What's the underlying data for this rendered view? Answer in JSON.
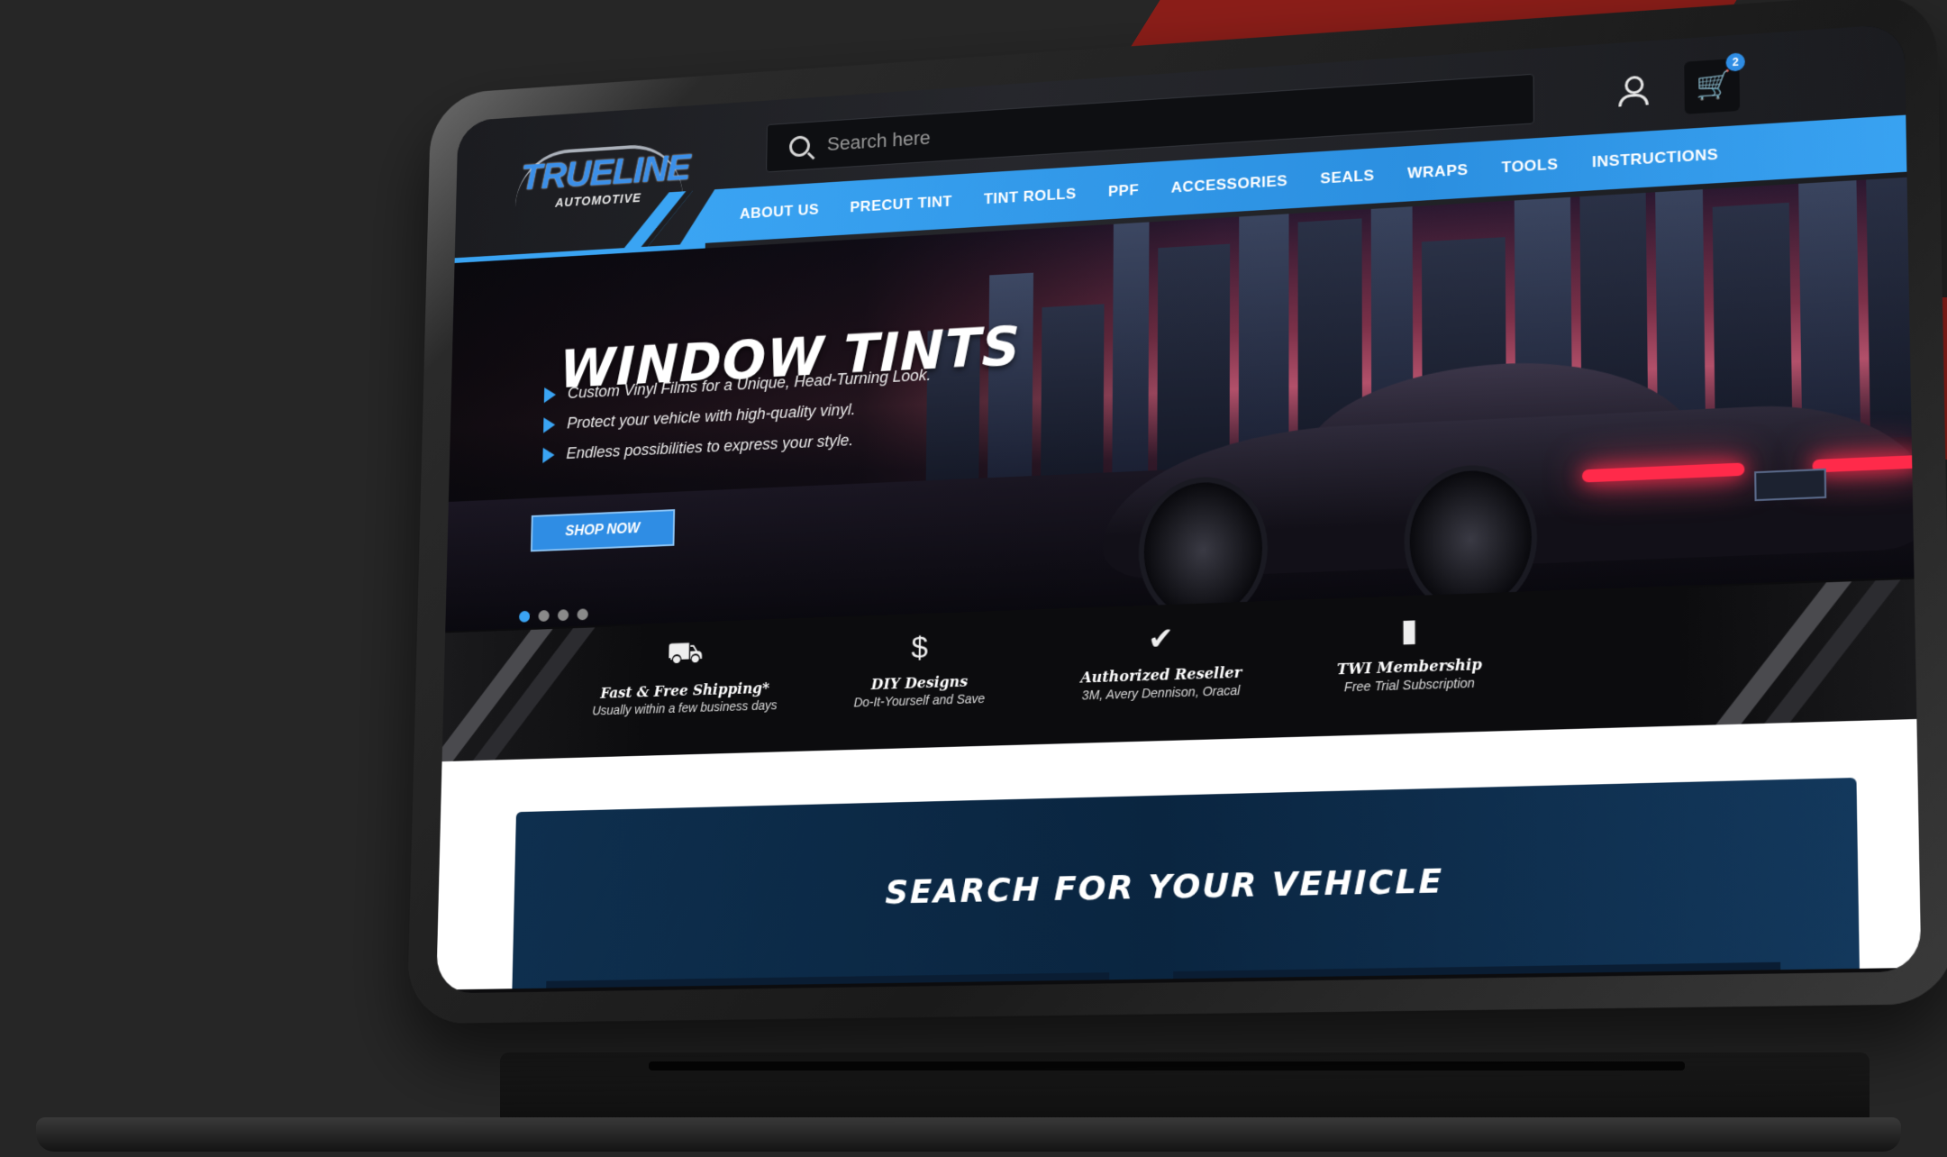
{
  "header": {
    "logo": {
      "main": "TRUELINE",
      "sub": "AUTOMOTIVE"
    },
    "search": {
      "placeholder": "Search here"
    },
    "cart": {
      "count": "2"
    },
    "nav": [
      {
        "label": "ABOUT US"
      },
      {
        "label": "PRECUT TINT"
      },
      {
        "label": "TINT ROLLS"
      },
      {
        "label": "PPF"
      },
      {
        "label": "ACCESSORIES"
      },
      {
        "label": "SEALS"
      },
      {
        "label": "WRAPS"
      },
      {
        "label": "TOOLS"
      },
      {
        "label": "INSTRUCTIONS"
      }
    ]
  },
  "hero": {
    "title": "WINDOW TINTS",
    "bullets": [
      "Custom Vinyl Films for a Unique, Head-Turning Look.",
      "Protect your vehicle with high-quality vinyl.",
      "Endless possibilities to express your style."
    ],
    "cta": "SHOP NOW",
    "slides": 4,
    "active_slide": 1
  },
  "features": [
    {
      "icon": "truck-icon",
      "title": "Fast & Free Shipping*",
      "sub": "Usually within a few business days"
    },
    {
      "icon": "money-hand-icon",
      "title": "DIY Designs",
      "sub": "Do-It-Yourself and Save"
    },
    {
      "icon": "badge-check-icon",
      "title": "Authorized Reseller",
      "sub": "3M, Avery Dennison, Oracal"
    },
    {
      "icon": "membership-card-icon",
      "title": "TWI Membership",
      "sub": "Free Trial Subscription"
    }
  ],
  "vehicle_search": {
    "title": "SEARCH FOR YOUR VEHICLE"
  },
  "colors": {
    "accent": "#2f8de4",
    "nav": "#3aa4f3",
    "panel": "#0a2540"
  }
}
